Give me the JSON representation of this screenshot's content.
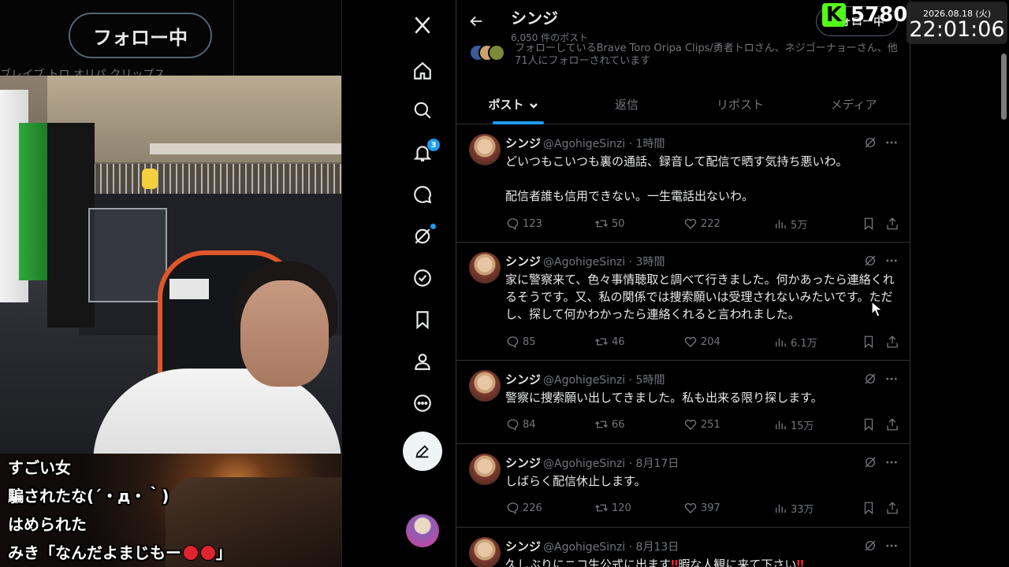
{
  "stream": {
    "ghost_follow_label": "フォロー中",
    "ghost_text": "ブレイブ トロ オリパ クリップス",
    "comments": [
      "すごい女",
      "騙されたな(´・д・｀)",
      "はめられた",
      "みき「なんだよまじもー"
    ]
  },
  "overlay": {
    "kick_logo": "K",
    "kick_count": "5780",
    "clock_date": "2026.08.18 (火)",
    "clock_time": "22:01:06"
  },
  "profile": {
    "name": "シンジ",
    "post_count": "6,050 件のポスト",
    "follow_label": "フォロー中",
    "followers_text": "フォローしているBrave Toro Oripa Clips/勇者トロさん、ネジゴーナョーさん、他71人にフォローされています"
  },
  "nav": {
    "notification_count": "3"
  },
  "tabs": {
    "posts": "ポスト",
    "replies": "返信",
    "reposts": "リポスト",
    "media": "メディア"
  },
  "posts": [
    {
      "name": "シンジ",
      "handle": "@AgohigeSinzi · 1時間",
      "text": "どいつもこいつも裏の通話、録音して配信で晒す気持ち悪いわ。\n\n配信者誰も信用できない。一生電話出ないわ。",
      "replies": "123",
      "reposts": "50",
      "likes": "222",
      "views": "5万"
    },
    {
      "name": "シンジ",
      "handle": "@AgohigeSinzi · 3時間",
      "text": "家に警察来て、色々事情聴取と調べて行きました。何かあったら連絡くれるそうです。又、私の関係では捜索願いは受理されないみたいです。ただし、探して何かわかったら連絡くれると言われました。",
      "replies": "85",
      "reposts": "46",
      "likes": "204",
      "views": "6.1万"
    },
    {
      "name": "シンジ",
      "handle": "@AgohigeSinzi · 5時間",
      "text": "警察に捜索願い出してきました。私も出来る限り探します。",
      "replies": "84",
      "reposts": "66",
      "likes": "251",
      "views": "15万"
    },
    {
      "name": "シンジ",
      "handle": "@AgohigeSinzi · 8月17日",
      "text": "しばらく配信休止します。",
      "replies": "226",
      "reposts": "120",
      "likes": "397",
      "views": "33万"
    },
    {
      "name": "シンジ",
      "handle": "@AgohigeSinzi · 8月13日",
      "text": "久しぶりにニコ生公式に出ます",
      "text_emoji": "‼",
      "text_tail": "暇な人観に来て下さい",
      "replies": "",
      "reposts": "",
      "likes": "",
      "views": ""
    }
  ],
  "colors": {
    "accent": "#1d9bf0",
    "kick_green": "#53fc18",
    "muted": "#71767b",
    "border": "#2f3336"
  }
}
